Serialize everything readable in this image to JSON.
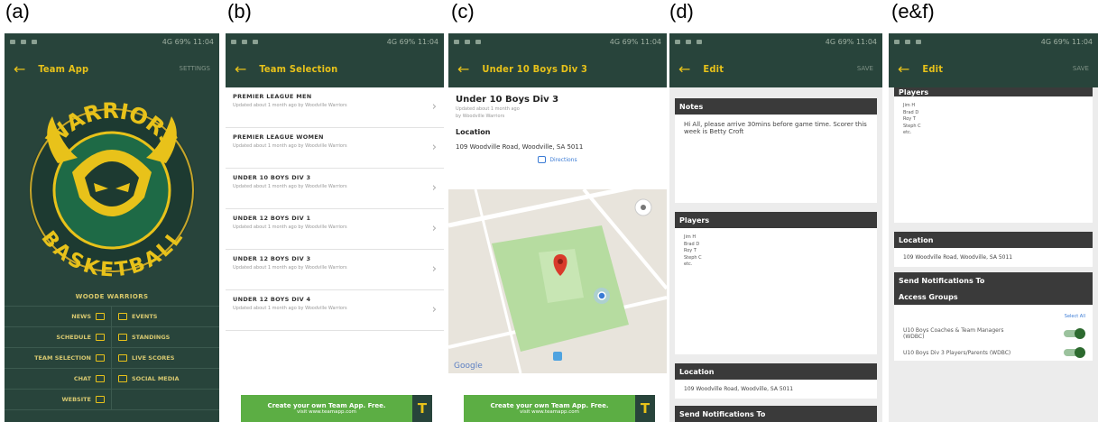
{
  "labels": {
    "a": "(a)",
    "b": "(b)",
    "c": "(c)",
    "d": "(d)",
    "e": "(e&f)"
  },
  "status": {
    "right": "4G 69% 11:04"
  },
  "panel_a": {
    "title": "Team App",
    "header_right": "SETTINGS",
    "logo_top": "WARRIORS",
    "logo_bottom": "BASKETBALL",
    "menu_title": "WOODE WARRIORS",
    "menu": [
      {
        "left": "NEWS",
        "right": "EVENTS"
      },
      {
        "left": "SCHEDULE",
        "right": "STANDINGS"
      },
      {
        "left": "TEAM SELECTION",
        "right": "LIVE SCORES"
      },
      {
        "left": "CHAT",
        "right": "SOCIAL MEDIA"
      },
      {
        "left": "WEBSITE",
        "right": ""
      }
    ]
  },
  "panel_b": {
    "title": "Team Selection",
    "items": [
      {
        "title": "PREMIER LEAGUE MEN",
        "sub": "Updated about 1 month ago by Woodville Warriors"
      },
      {
        "title": "PREMIER LEAGUE WOMEN",
        "sub": "Updated about 1 month ago by Woodville Warriors"
      },
      {
        "title": "UNDER 10 BOYS DIV 3",
        "sub": "Updated about 1 month ago by Woodville Warriors"
      },
      {
        "title": "UNDER 12 BOYS DIV 1",
        "sub": "Updated about 1 month ago by Woodville Warriors"
      },
      {
        "title": "UNDER 12 BOYS DIV 3",
        "sub": "Updated about 1 month ago by Woodville Warriors"
      },
      {
        "title": "UNDER 12 BOYS DIV 4",
        "sub": "Updated about 1 month ago by Woodville Warriors"
      }
    ],
    "ad_line1": "Create your own Team App. Free.",
    "ad_line2": "visit www.teamapp.com",
    "ad_logo": "T"
  },
  "panel_c": {
    "title": "Under 10 Boys Div 3",
    "heading": "Under 10 Boys Div 3",
    "updated": "Updated about 1 month ago",
    "by": "by Woodville Warriors",
    "location_label": "Location",
    "address": "109 Woodville Road, Woodville, SA 5011",
    "directions": "Directions",
    "google": "Google",
    "ad_line1": "Create your own Team App. Free.",
    "ad_line2": "visit www.teamapp.com",
    "ad_logo": "T"
  },
  "panel_d": {
    "title": "Edit",
    "header_right": "SAVE",
    "notes_label": "Notes",
    "notes_text": "Hi All, please arrive 30mins before game time. Scorer this week is Betty Croft",
    "players_label": "Players",
    "players": [
      "Jim H",
      "Brad D",
      "Roy T",
      "Steph C",
      "etc."
    ],
    "location_label": "Location",
    "address": "109 Woodville Road, Woodville, SA 5011",
    "send_label": "Send Notifications To"
  },
  "panel_e": {
    "title": "Edit",
    "header_right": "SAVE",
    "players_label": "Players",
    "players": [
      "Jim H",
      "Brad D",
      "Roy T",
      "Steph C",
      "etc."
    ],
    "location_label": "Location",
    "address": "109 Woodville Road, Woodville, SA 5011",
    "send_label": "Send Notifications To",
    "access_label": "Access Groups",
    "select_all": "Select All",
    "groups": [
      {
        "label": "U10 Boys Coaches & Team Managers (WDBC)",
        "on": true
      },
      {
        "label": "U10 Boys Div 3 Players/Parents (WDBC)",
        "on": true
      }
    ]
  },
  "colors": {
    "dark_green": "#28443b",
    "gold": "#e8c21a",
    "ad_green": "#5cae44"
  }
}
